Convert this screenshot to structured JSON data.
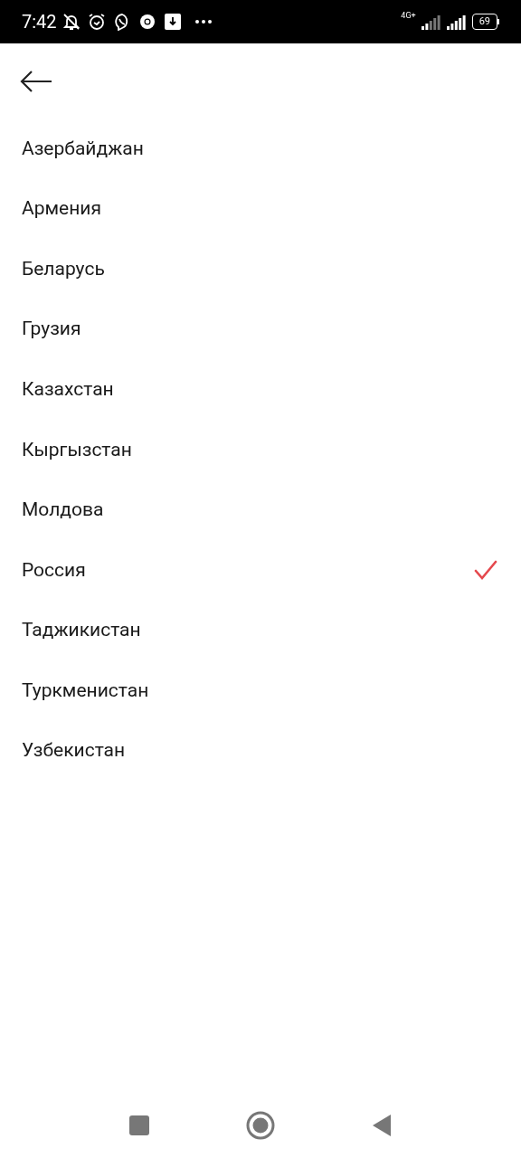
{
  "status_bar": {
    "time": "7:42",
    "network": "4G+",
    "battery": "69"
  },
  "countries": [
    {
      "name": "Азербайджан",
      "selected": false
    },
    {
      "name": "Армения",
      "selected": false
    },
    {
      "name": "Беларусь",
      "selected": false
    },
    {
      "name": "Грузия",
      "selected": false
    },
    {
      "name": "Казахстан",
      "selected": false
    },
    {
      "name": "Кыргызстан",
      "selected": false
    },
    {
      "name": "Молдова",
      "selected": false
    },
    {
      "name": "Россия",
      "selected": true
    },
    {
      "name": "Таджикистан",
      "selected": false
    },
    {
      "name": "Туркменистан",
      "selected": false
    },
    {
      "name": "Узбекистан",
      "selected": false
    }
  ]
}
